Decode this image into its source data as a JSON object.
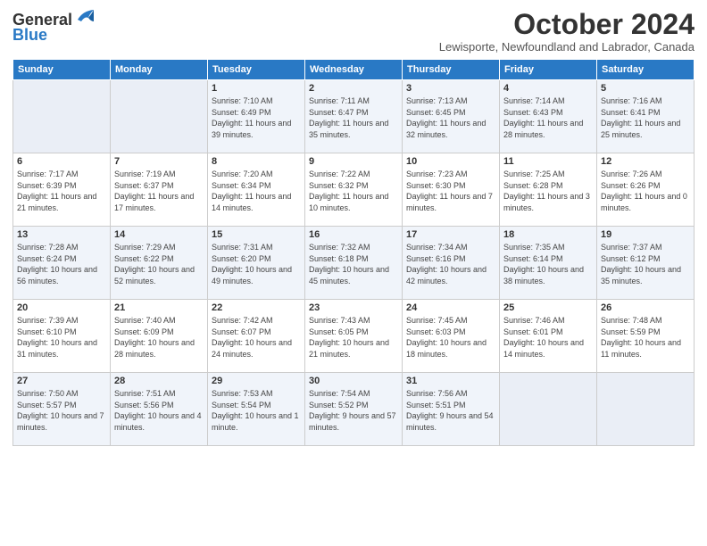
{
  "logo": {
    "line1": "General",
    "line2": "Blue"
  },
  "header": {
    "month": "October 2024",
    "location": "Lewisporte, Newfoundland and Labrador, Canada"
  },
  "weekdays": [
    "Sunday",
    "Monday",
    "Tuesday",
    "Wednesday",
    "Thursday",
    "Friday",
    "Saturday"
  ],
  "weeks": [
    [
      {
        "day": "",
        "info": ""
      },
      {
        "day": "",
        "info": ""
      },
      {
        "day": "1",
        "info": "Sunrise: 7:10 AM\nSunset: 6:49 PM\nDaylight: 11 hours and 39 minutes."
      },
      {
        "day": "2",
        "info": "Sunrise: 7:11 AM\nSunset: 6:47 PM\nDaylight: 11 hours and 35 minutes."
      },
      {
        "day": "3",
        "info": "Sunrise: 7:13 AM\nSunset: 6:45 PM\nDaylight: 11 hours and 32 minutes."
      },
      {
        "day": "4",
        "info": "Sunrise: 7:14 AM\nSunset: 6:43 PM\nDaylight: 11 hours and 28 minutes."
      },
      {
        "day": "5",
        "info": "Sunrise: 7:16 AM\nSunset: 6:41 PM\nDaylight: 11 hours and 25 minutes."
      }
    ],
    [
      {
        "day": "6",
        "info": "Sunrise: 7:17 AM\nSunset: 6:39 PM\nDaylight: 11 hours and 21 minutes."
      },
      {
        "day": "7",
        "info": "Sunrise: 7:19 AM\nSunset: 6:37 PM\nDaylight: 11 hours and 17 minutes."
      },
      {
        "day": "8",
        "info": "Sunrise: 7:20 AM\nSunset: 6:34 PM\nDaylight: 11 hours and 14 minutes."
      },
      {
        "day": "9",
        "info": "Sunrise: 7:22 AM\nSunset: 6:32 PM\nDaylight: 11 hours and 10 minutes."
      },
      {
        "day": "10",
        "info": "Sunrise: 7:23 AM\nSunset: 6:30 PM\nDaylight: 11 hours and 7 minutes."
      },
      {
        "day": "11",
        "info": "Sunrise: 7:25 AM\nSunset: 6:28 PM\nDaylight: 11 hours and 3 minutes."
      },
      {
        "day": "12",
        "info": "Sunrise: 7:26 AM\nSunset: 6:26 PM\nDaylight: 11 hours and 0 minutes."
      }
    ],
    [
      {
        "day": "13",
        "info": "Sunrise: 7:28 AM\nSunset: 6:24 PM\nDaylight: 10 hours and 56 minutes."
      },
      {
        "day": "14",
        "info": "Sunrise: 7:29 AM\nSunset: 6:22 PM\nDaylight: 10 hours and 52 minutes."
      },
      {
        "day": "15",
        "info": "Sunrise: 7:31 AM\nSunset: 6:20 PM\nDaylight: 10 hours and 49 minutes."
      },
      {
        "day": "16",
        "info": "Sunrise: 7:32 AM\nSunset: 6:18 PM\nDaylight: 10 hours and 45 minutes."
      },
      {
        "day": "17",
        "info": "Sunrise: 7:34 AM\nSunset: 6:16 PM\nDaylight: 10 hours and 42 minutes."
      },
      {
        "day": "18",
        "info": "Sunrise: 7:35 AM\nSunset: 6:14 PM\nDaylight: 10 hours and 38 minutes."
      },
      {
        "day": "19",
        "info": "Sunrise: 7:37 AM\nSunset: 6:12 PM\nDaylight: 10 hours and 35 minutes."
      }
    ],
    [
      {
        "day": "20",
        "info": "Sunrise: 7:39 AM\nSunset: 6:10 PM\nDaylight: 10 hours and 31 minutes."
      },
      {
        "day": "21",
        "info": "Sunrise: 7:40 AM\nSunset: 6:09 PM\nDaylight: 10 hours and 28 minutes."
      },
      {
        "day": "22",
        "info": "Sunrise: 7:42 AM\nSunset: 6:07 PM\nDaylight: 10 hours and 24 minutes."
      },
      {
        "day": "23",
        "info": "Sunrise: 7:43 AM\nSunset: 6:05 PM\nDaylight: 10 hours and 21 minutes."
      },
      {
        "day": "24",
        "info": "Sunrise: 7:45 AM\nSunset: 6:03 PM\nDaylight: 10 hours and 18 minutes."
      },
      {
        "day": "25",
        "info": "Sunrise: 7:46 AM\nSunset: 6:01 PM\nDaylight: 10 hours and 14 minutes."
      },
      {
        "day": "26",
        "info": "Sunrise: 7:48 AM\nSunset: 5:59 PM\nDaylight: 10 hours and 11 minutes."
      }
    ],
    [
      {
        "day": "27",
        "info": "Sunrise: 7:50 AM\nSunset: 5:57 PM\nDaylight: 10 hours and 7 minutes."
      },
      {
        "day": "28",
        "info": "Sunrise: 7:51 AM\nSunset: 5:56 PM\nDaylight: 10 hours and 4 minutes."
      },
      {
        "day": "29",
        "info": "Sunrise: 7:53 AM\nSunset: 5:54 PM\nDaylight: 10 hours and 1 minute."
      },
      {
        "day": "30",
        "info": "Sunrise: 7:54 AM\nSunset: 5:52 PM\nDaylight: 9 hours and 57 minutes."
      },
      {
        "day": "31",
        "info": "Sunrise: 7:56 AM\nSunset: 5:51 PM\nDaylight: 9 hours and 54 minutes."
      },
      {
        "day": "",
        "info": ""
      },
      {
        "day": "",
        "info": ""
      }
    ]
  ]
}
